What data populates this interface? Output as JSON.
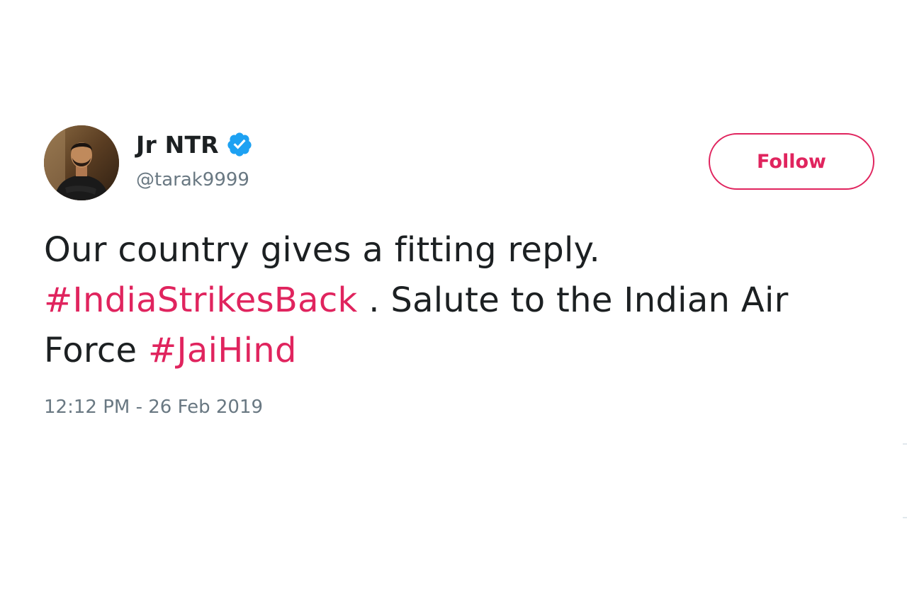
{
  "user": {
    "display_name": "Jr NTR",
    "handle": "@tarak9999",
    "verified": true,
    "avatar_icon": "profile-photo"
  },
  "follow_button": {
    "label": "Follow",
    "color": "#e0245e"
  },
  "tweet": {
    "line1": "Our country gives a fitting reply.",
    "hashtag1": "#IndiaStrikesBack",
    "line2_rest": " . Salute to the Indian Air",
    "line3_start": "Force ",
    "hashtag2": "#JaiHind",
    "timestamp": "12:12 PM - 26 Feb 2019"
  },
  "colors": {
    "accent": "#e0245e",
    "text": "#1c2022",
    "secondary": "#697882",
    "verified_badge": "#1da1f2"
  }
}
